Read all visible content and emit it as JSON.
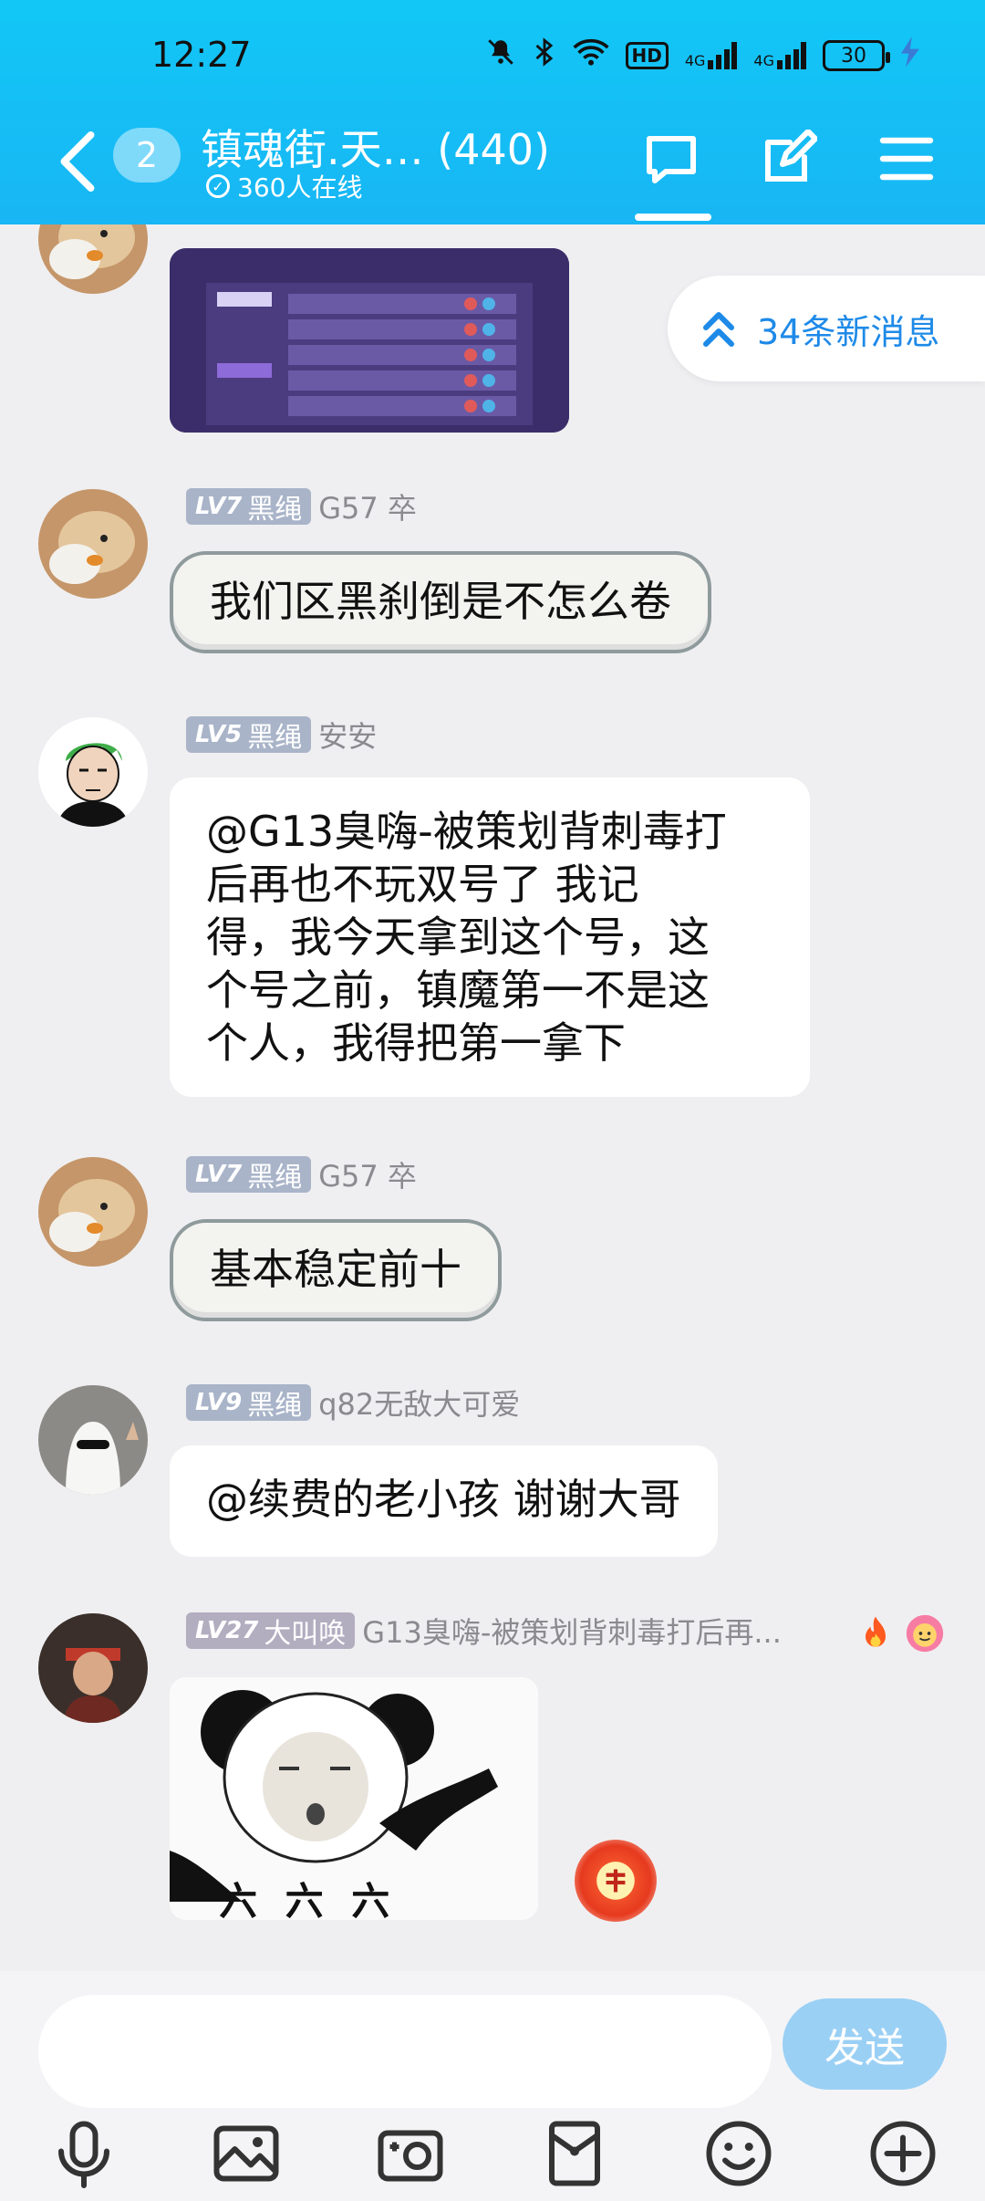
{
  "status_bar": {
    "time": "12:27",
    "network_a": "4G",
    "network_b": "4G",
    "hd_label": "HD",
    "battery": "30"
  },
  "header": {
    "unread_count": "2",
    "title": "镇魂街.天… (440)",
    "online": "360人在线"
  },
  "new_messages": "34条新消息",
  "messages": [
    {
      "level": "LV7",
      "title_badge": "黑绳",
      "nick": "G57 卒",
      "text": "我们区黑刹倒是不怎么卷",
      "style": "cloud"
    },
    {
      "level": "LV5",
      "title_badge": "黑绳",
      "nick": "安安",
      "lines": [
        "@G13臭嗨-被策划背刺毒打",
        "后再也不玩双号了 我记",
        "得，我今天拿到这个号，这",
        "个号之前，镇魔第一不是这",
        "个人，我得把第一拿下"
      ]
    },
    {
      "level": "LV7",
      "title_badge": "黑绳",
      "nick": "G57 卒",
      "text": "基本稳定前十",
      "style": "cloud"
    },
    {
      "level": "LV9",
      "title_badge": "黑绳",
      "nick": "q82无敌大可爱",
      "text": "@续费的老小孩 谢谢大哥"
    },
    {
      "level": "LV27",
      "title_badge": "大叫唤",
      "nick": "G13臭嗨-被策划背刺毒打后再...",
      "sticker_caption": "六 六 六"
    }
  ],
  "input": {
    "placeholder": "",
    "send_label": "发送"
  },
  "icons": {
    "back": "chevron-left-icon",
    "chat": "chat-bubble-icon",
    "edit": "edit-icon",
    "menu": "menu-icon",
    "voice": "microphone-icon",
    "image": "image-icon",
    "camera": "camera-icon",
    "red_packet": "red-packet-icon",
    "emoji": "emoji-icon",
    "plus": "plus-icon"
  },
  "colors": {
    "header": "#12c7f6",
    "accent": "#1e8ae8",
    "send_button": "#9bd0f5"
  }
}
